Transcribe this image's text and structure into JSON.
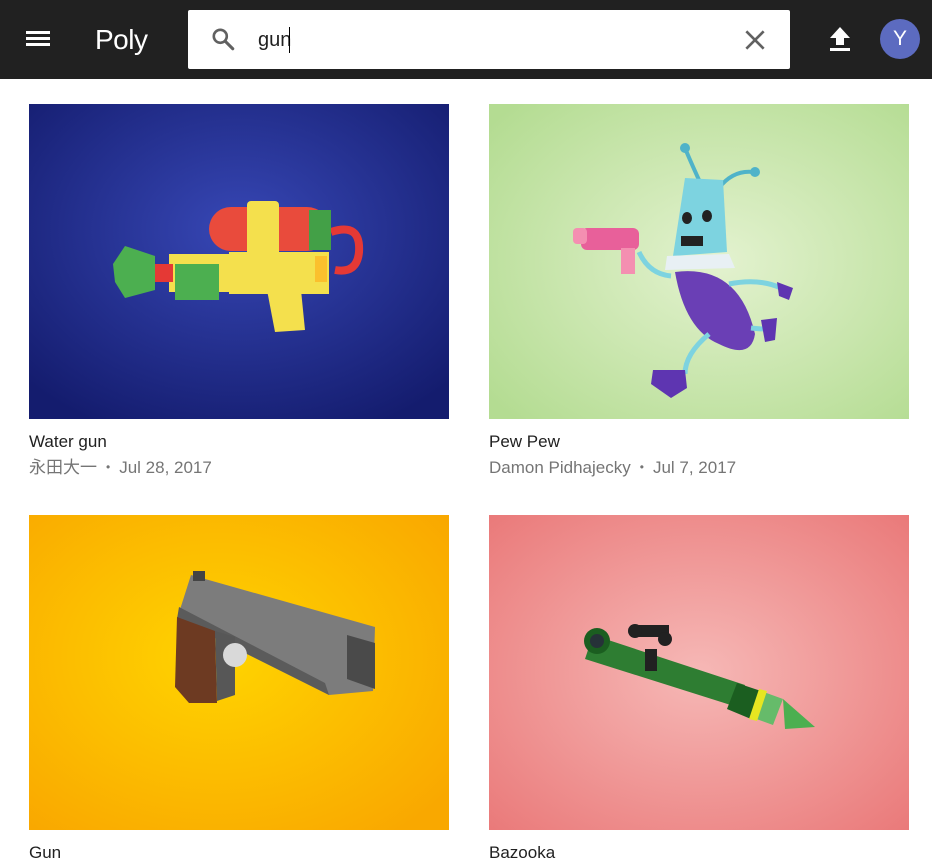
{
  "app": {
    "name": "Poly"
  },
  "search": {
    "value": "gun",
    "placeholder": ""
  },
  "user": {
    "avatar_initial": "Y",
    "avatar_color": "#5c6bc0"
  },
  "colors": {
    "topbar": "#212121",
    "text_primary": "#212121",
    "text_secondary": "#757575"
  },
  "icons": [
    "menu-icon",
    "search-icon",
    "close-icon",
    "upload-icon"
  ],
  "results": [
    {
      "title": "Water gun",
      "author": "永田大一",
      "date": "Jul 28, 2017",
      "background": "#1e2a8c"
    },
    {
      "title": "Pew Pew",
      "author": "Damon Pidhajecky",
      "date": "Jul 7, 2017",
      "background": "#c5e4a8"
    },
    {
      "title": "Gun",
      "author": "",
      "date": "",
      "background": "#fbb400"
    },
    {
      "title": "Bazooka",
      "author": "",
      "date": "",
      "background": "#ef9a9a"
    }
  ]
}
